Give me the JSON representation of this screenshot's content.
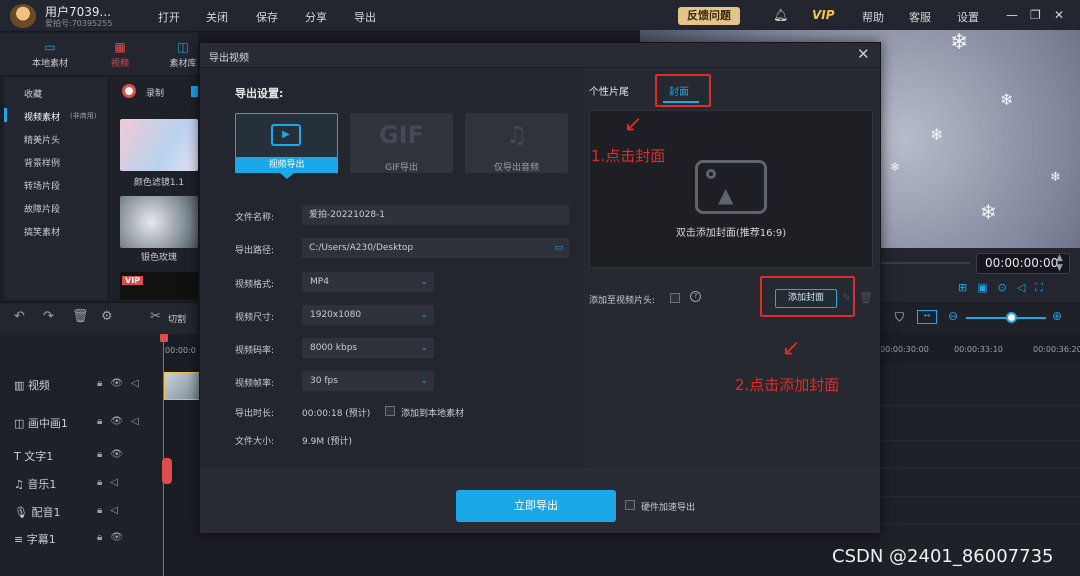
{
  "topbar": {
    "username": "用户7039...",
    "user_id": "爱拍号:70395255",
    "menu": [
      "打开",
      "关闭",
      "保存",
      "分享",
      "导出"
    ],
    "feedback": "反馈问题",
    "vip": "VIP",
    "help": "帮助",
    "service": "客服",
    "settings": "设置"
  },
  "left_tabs": [
    "本地素材",
    "视频",
    "素材库"
  ],
  "record_label": "录制",
  "categories": [
    "收藏",
    "视频素材",
    "精美片头",
    "背景样例",
    "转场片段",
    "故障片段",
    "搞笑素材"
  ],
  "common_tag": "(非商用)",
  "thumbnails": [
    {
      "label": "颜色滤镜1.1"
    },
    {
      "label": "银色玫瑰"
    }
  ],
  "vip_badge": "VIP",
  "timeline": {
    "cut_label": "切割",
    "start_time": "00:00:0",
    "tracks": [
      "视频",
      "画中画1",
      "文字1",
      "音乐1",
      "配音1",
      "字幕1"
    ],
    "ruler": [
      "00:00:30:00",
      "00:00:33:10",
      "00:00:36:20"
    ],
    "timecode": "00:00:00:00"
  },
  "dialog": {
    "title": "导出视频",
    "settings_title": "导出设置:",
    "options": [
      {
        "label": "视频导出",
        "big": ""
      },
      {
        "label": "GIF导出",
        "big": "GIF"
      },
      {
        "label": "仅导出音频",
        "big": "♫"
      }
    ],
    "fields": {
      "filename_label": "文件名称:",
      "filename": "爱拍-20221028-1",
      "path_label": "导出路径:",
      "path": "C:/Users/A230/Desktop",
      "format_label": "视频格式:",
      "format": "MP4",
      "size_label": "视频尺寸:",
      "size": "1920x1080",
      "bitrate_label": "视频码率:",
      "bitrate": "8000 kbps",
      "fps_label": "视频帧率:",
      "fps": "30 fps",
      "duration_label": "导出时长:",
      "duration": "00:00:18 (预计)",
      "add_local": "添加到本地素材",
      "filesize_label": "文件大小:",
      "filesize": "9.9M (预计)"
    },
    "export_button": "立即导出",
    "hw_accel": "硬件加速导出",
    "tabs": {
      "ending": "个性片尾",
      "cover": "封面"
    },
    "cover_hint": "双击添加封面(推荐16:9)",
    "add_to_start": "添加至视频片头:",
    "add_cover_button": "添加封面"
  },
  "annotations": {
    "step1": "1.点击封面",
    "step2": "2.点击添加封面",
    "accent": "#e12a2a"
  },
  "watermark": "CSDN @2401_86007735",
  "colors": {
    "accent": "#1aa8e8",
    "vip": "#f0c84a",
    "feedback": "#e4c48a"
  }
}
